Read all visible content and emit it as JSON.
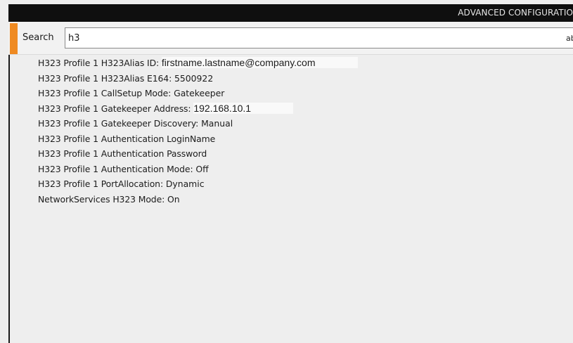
{
  "window": {
    "title": "ADVANCED CONFIGURATIO"
  },
  "search": {
    "label": "Search",
    "value": "h3",
    "mode_indicator": "ab"
  },
  "results": [
    {
      "key": "H323 Profile 1 H323Alias ID: ",
      "value": "firstname.lastname@company.com",
      "highlight": true
    },
    {
      "key": "H323 Profile 1 H323Alias E164: ",
      "value": "5500922",
      "highlight": false
    },
    {
      "key": "H323 Profile 1 CallSetup Mode: ",
      "value": "Gatekeeper",
      "highlight": false
    },
    {
      "key": "H323 Profile 1 Gatekeeper Address: ",
      "value": "192.168.10.1",
      "highlight": true
    },
    {
      "key": "H323 Profile 1 Gatekeeper Discovery: ",
      "value": "Manual",
      "highlight": false
    },
    {
      "key": "H323 Profile 1 Authentication LoginName",
      "value": "",
      "highlight": false
    },
    {
      "key": "H323 Profile 1 Authentication Password",
      "value": "",
      "highlight": false
    },
    {
      "key": "H323 Profile 1 Authentication Mode: ",
      "value": "Off",
      "highlight": false
    },
    {
      "key": "H323 Profile 1 PortAllocation: ",
      "value": "Dynamic",
      "highlight": false
    },
    {
      "key": "NetworkServices H323 Mode: ",
      "value": "On",
      "highlight": false
    }
  ],
  "colors": {
    "accent": "#ef8a22",
    "topbar": "#0f0f0f",
    "background": "#eeeeee"
  }
}
